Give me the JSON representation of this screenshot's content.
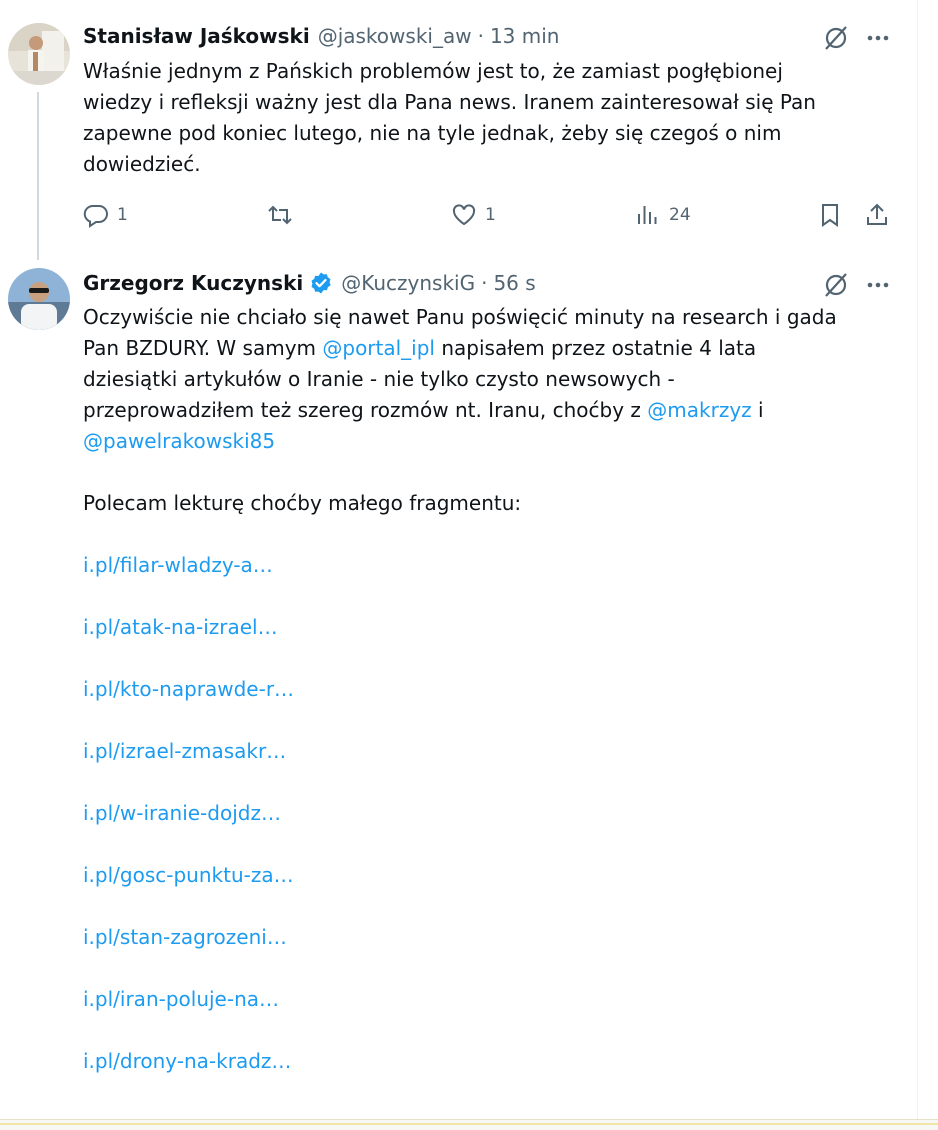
{
  "tweet1": {
    "name": "Stanisław Jaśkowski",
    "handle": "@jaskowski_aw",
    "separator": "·",
    "time": "13 min",
    "lines": [
      "Właśnie jednym z Pańskich problemów jest to, że zamiast pogłębionej",
      "wiedzy i refleksji ważny jest dla Pana news. Iranem zainteresował się Pan",
      "zapewne pod koniec lutego, nie na tyle jednak, żeby się czegoś o nim",
      "dowiedzieć."
    ],
    "actions": {
      "reply_count": "1",
      "retweet_count": "",
      "like_count": "1",
      "views_count": "24"
    }
  },
  "tweet2": {
    "name": "Grzegorz Kuczynski",
    "handle": "@KuczynskiG",
    "separator": "·",
    "time": "56 s",
    "line1": "Oczywiście nie chciało się nawet Panu poświęcić minuty na research i gada",
    "line2_a": "Pan BZDURY. W samym ",
    "line2_link": "@portal_ipl",
    "line2_b": " napisałem przez ostatnie 4 lata",
    "line3": "dziesiątki artykułów o Iranie - nie tylko czysto newsowych -",
    "line4_a": "przeprowadziłem też szereg rozmów nt. Iranu, choćby z ",
    "line4_link": "@makrzyz",
    "line4_b": " i",
    "line5_link": "@pawelrakowski85",
    "line7": "Polecam lekturę choćby małego fragmentu:",
    "urls": [
      "i.pl/filar-wladzy-a…",
      "i.pl/atak-na-izrael…",
      "i.pl/kto-naprawde-r…",
      "i.pl/izrael-zmasakr…",
      "i.pl/w-iranie-dojdz…",
      "i.pl/gosc-punktu-za…",
      "i.pl/stan-zagrozeni…",
      "i.pl/iran-poluje-na…",
      "i.pl/drony-na-kradz…"
    ]
  },
  "colors": {
    "text": "#0f1419",
    "secondary": "#536471",
    "link": "#1d9bf0",
    "verified": "#1d9bf0",
    "thread_line": "#cfd9de"
  },
  "icons": {
    "reply": "reply-icon",
    "retweet": "retweet-icon",
    "like": "like-icon",
    "views": "views-icon",
    "bookmark": "bookmark-icon",
    "share": "share-icon",
    "grok": "grok-icon",
    "more": "more-icon",
    "verified": "verified-badge-icon"
  }
}
